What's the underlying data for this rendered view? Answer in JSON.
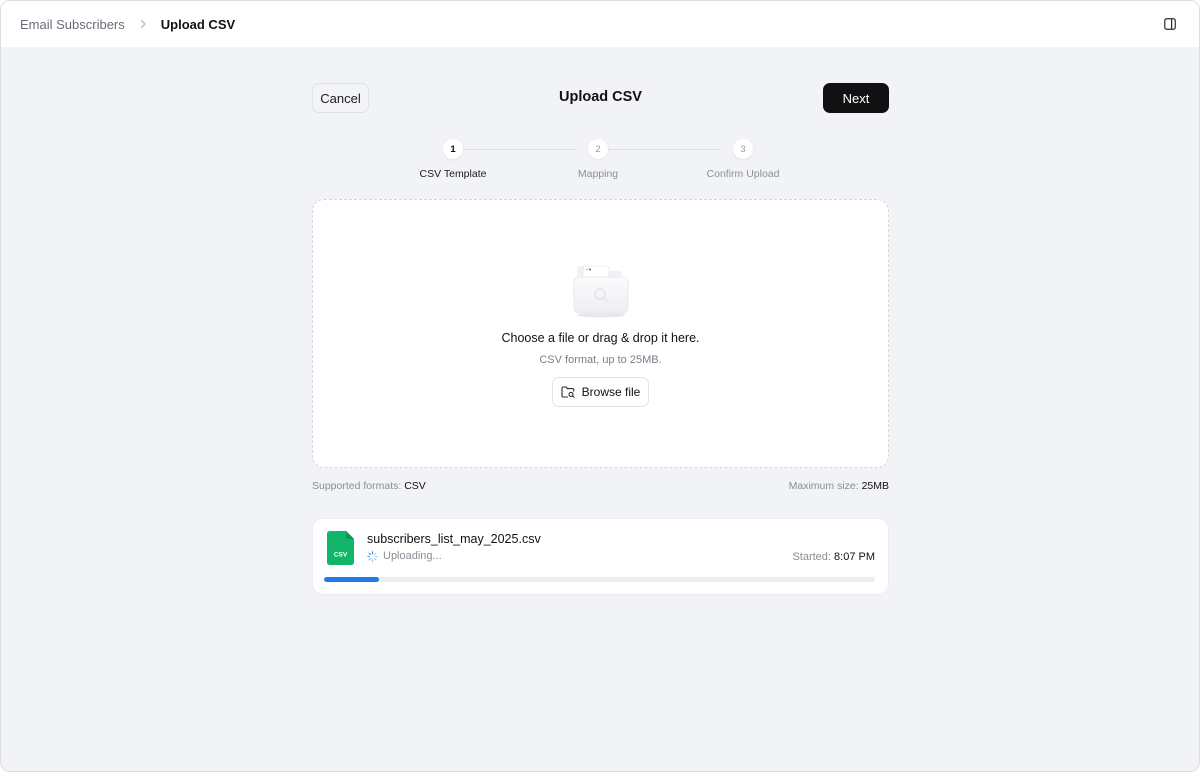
{
  "breadcrumb": {
    "root": "Email Subscribers",
    "current": "Upload CSV"
  },
  "header": {
    "cancel_label": "Cancel",
    "title": "Upload CSV",
    "next_label": "Next"
  },
  "steps": [
    {
      "number": "1",
      "label": "CSV Template",
      "active": true
    },
    {
      "number": "2",
      "label": "Mapping",
      "active": false
    },
    {
      "number": "3",
      "label": "Confirm Upload",
      "active": false
    }
  ],
  "dropzone": {
    "title": "Choose a file or drag & drop it here.",
    "subtitle": "CSV format, up to 25MB.",
    "browse_label": "Browse file"
  },
  "limits": {
    "formats_label": "Supported formats:",
    "formats_value": "CSV",
    "max_size_label": "Maximum size:",
    "max_size_value": "25MB"
  },
  "upload": {
    "file_name": "subscribers_list_may_2025.csv",
    "file_type": "CSV",
    "status": "Uploading...",
    "started_label": "Started:",
    "started_time": "8:07 PM",
    "progress": 0.1
  },
  "colors": {
    "accent": "#1f7be8",
    "primary_button": "#111114",
    "file_icon": "#12b66a",
    "background": "#f2f3f7"
  },
  "icons": {
    "breadcrumb_separator": "chevron-right-icon",
    "panel_toggle": "sidebar-panel-icon",
    "upload_illustration": "folder-illustration",
    "browse": "folder-search-icon",
    "file": "csv-file-icon",
    "status": "spinner-icon"
  }
}
